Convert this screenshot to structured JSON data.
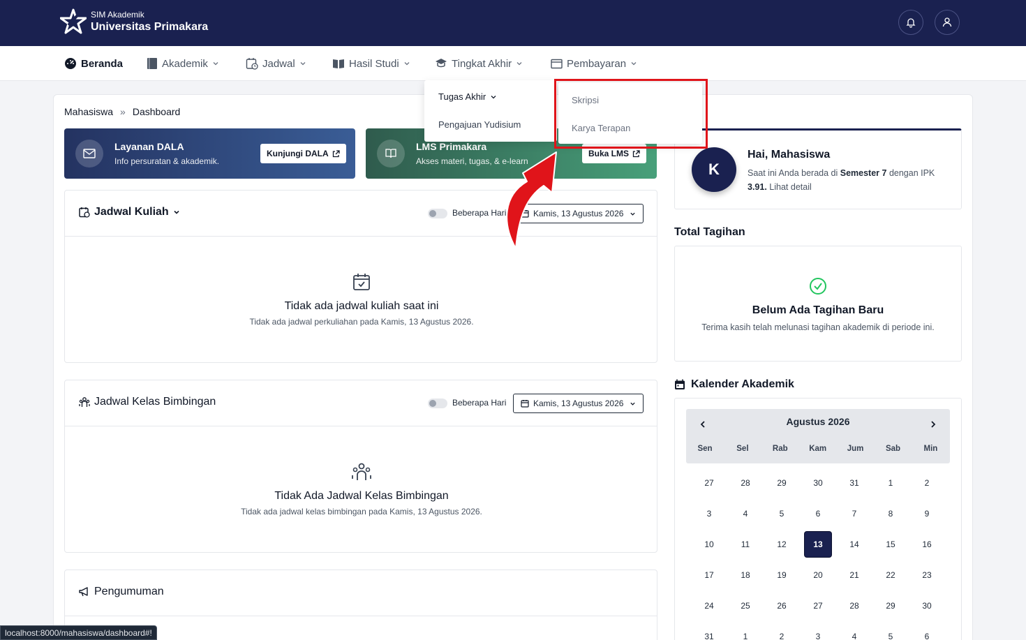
{
  "brand": {
    "sub": "SIM Akademik",
    "main": "Universitas Primakara"
  },
  "nav": {
    "beranda": "Beranda",
    "akademik": "Akademik",
    "jadwal": "Jadwal",
    "hasil_studi": "Hasil Studi",
    "tingkat_akhir": "Tingkat Akhir",
    "pembayaran": "Pembayaran"
  },
  "dropdown": {
    "tugas_akhir": "Tugas Akhir",
    "pengajuan_yudisium": "Pengajuan Yudisium",
    "sub_items": [
      "Skripsi",
      "Karya Terapan"
    ]
  },
  "breadcrumb": {
    "parent": "Mahasiswa",
    "current": "Dashboard"
  },
  "banners": {
    "dala": {
      "title": "Layanan DALA",
      "desc": "Info persuratan & akademik.",
      "button": "Kunjungi DALA"
    },
    "lms": {
      "title": "LMS Primakara",
      "desc": "Akses materi, tugas, & e-learn",
      "button": "Buka LMS"
    }
  },
  "jadwal_kuliah": {
    "title": "Jadwal Kuliah",
    "toggle_label": "Beberapa Hari",
    "date": "Kamis, 13 Agustus 2026",
    "empty_title": "Tidak ada jadwal kuliah saat ini",
    "empty_desc": "Tidak ada jadwal perkuliahan pada Kamis, 13 Agustus 2026."
  },
  "jadwal_bimbingan": {
    "title": "Jadwal Kelas Bimbingan",
    "toggle_label": "Beberapa Hari",
    "date": "Kamis, 13 Agustus 2026",
    "empty_title": "Tidak Ada Jadwal Kelas Bimbingan",
    "empty_desc": "Tidak ada jadwal kelas bimbingan pada Kamis, 13 Agustus 2026."
  },
  "pengumuman": {
    "title": "Pengumuman"
  },
  "profile": {
    "initial": "K",
    "greeting": "Hai, Mahasiswa",
    "desc_1": "Saat ini Anda berada di ",
    "semester": "Semester 7",
    "desc_2": " dengan IPK ",
    "ipk": "3.91.",
    "link": " Lihat detail"
  },
  "tagihan": {
    "section": "Total Tagihan",
    "title": "Belum Ada Tagihan Baru",
    "desc": "Terima kasih telah melunasi tagihan akademik di periode ini."
  },
  "kalender": {
    "section": "Kalender Akademik",
    "month": "Agustus 2026",
    "dow": [
      "Sen",
      "Sel",
      "Rab",
      "Kam",
      "Jum",
      "Sab",
      "Min"
    ],
    "weeks": [
      [
        "27",
        "28",
        "29",
        "30",
        "31",
        "1",
        "2"
      ],
      [
        "3",
        "4",
        "5",
        "6",
        "7",
        "8",
        "9"
      ],
      [
        "10",
        "11",
        "12",
        "13",
        "14",
        "15",
        "16"
      ],
      [
        "17",
        "18",
        "19",
        "20",
        "21",
        "22",
        "23"
      ],
      [
        "24",
        "25",
        "26",
        "27",
        "28",
        "29",
        "30"
      ],
      [
        "31",
        "1",
        "2",
        "3",
        "4",
        "5",
        "6"
      ]
    ],
    "today": "13"
  },
  "status_url": "localhost:8000/mahasiswa/dashboard#!",
  "colors": {
    "navy": "#1a2150",
    "highlight": "#e0141a",
    "success": "#22c55e"
  }
}
